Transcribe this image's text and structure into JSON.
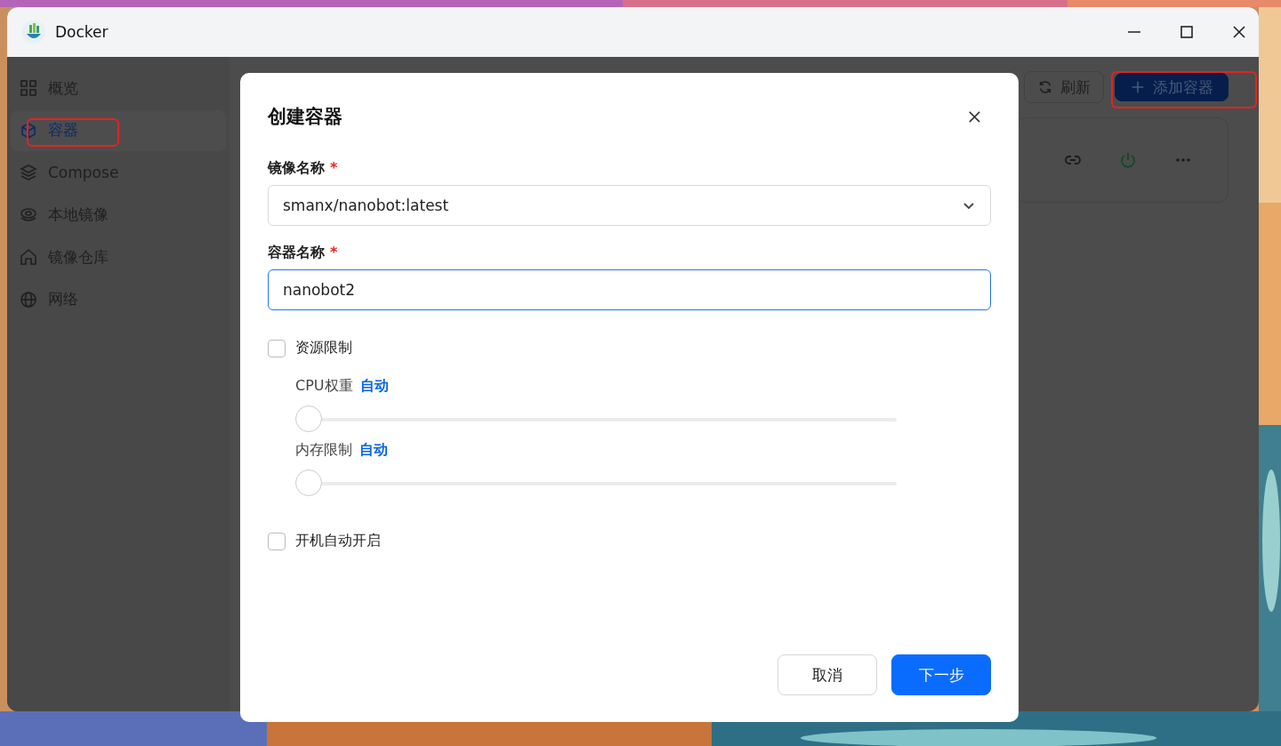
{
  "window": {
    "title": "Docker"
  },
  "sidebar": {
    "items": [
      {
        "label": "概览",
        "selected": false
      },
      {
        "label": "容器",
        "selected": true
      },
      {
        "label": "Compose",
        "selected": false
      },
      {
        "label": "本地镜像",
        "selected": false
      },
      {
        "label": "镜像仓库",
        "selected": false
      },
      {
        "label": "网络",
        "selected": false
      }
    ]
  },
  "toolbar": {
    "buttons": [
      {
        "label": "刷新",
        "kind": "refresh"
      },
      {
        "label": "添加容器",
        "kind": "add"
      }
    ]
  },
  "dialog": {
    "title": "创建容器",
    "fields": [
      {
        "label": "镜像名称",
        "required_mark": "*",
        "kind": "select",
        "value": "smanx/nanobot:latest",
        "focused": false
      },
      {
        "label": "容器名称",
        "required_mark": "*",
        "kind": "text",
        "value": "nanobot2",
        "focused": true
      }
    ],
    "resource_limit": {
      "label": "资源限制",
      "checked": false,
      "sliders": [
        {
          "label": "CPU权重",
          "value": "自动",
          "level": 0
        },
        {
          "label": "内存限制",
          "value": "自动",
          "level": 0
        }
      ]
    },
    "autostart": {
      "label": "开机自动开启",
      "checked": false
    },
    "buttons": [
      {
        "label": "取消",
        "kind": "secondary"
      },
      {
        "label": "下一步",
        "kind": "primary"
      }
    ]
  }
}
